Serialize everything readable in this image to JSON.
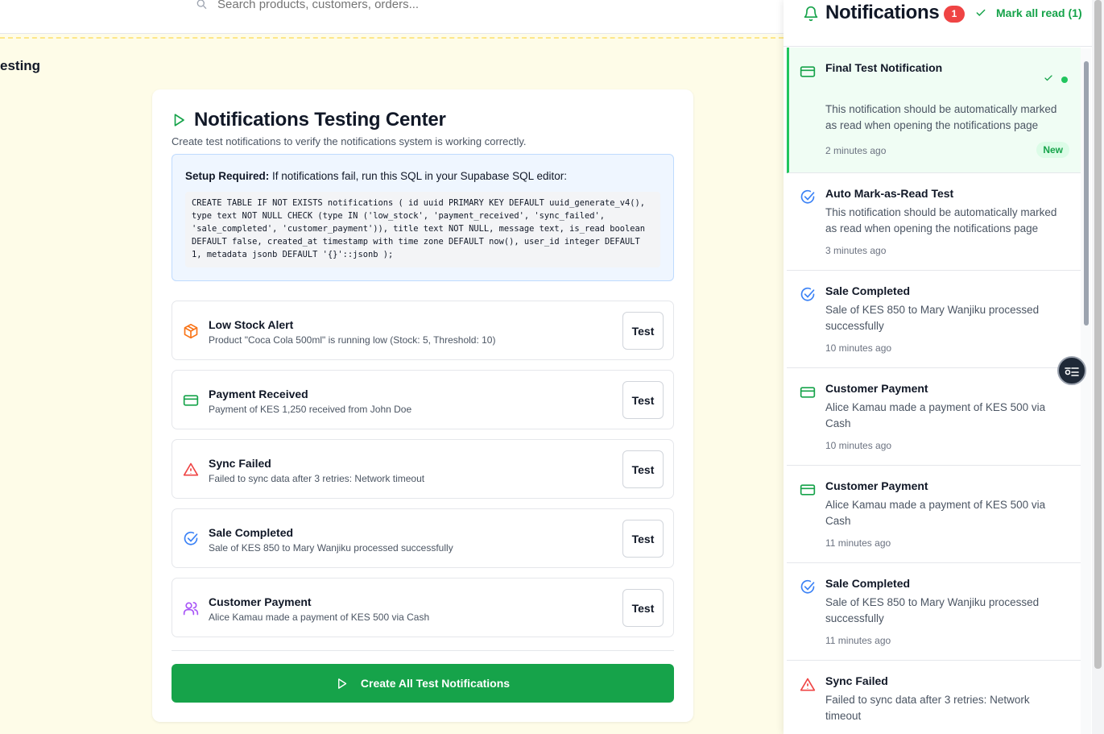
{
  "search": {
    "placeholder": "Search products, customers, orders..."
  },
  "page": {
    "heading_fragment": "esting"
  },
  "testing_center": {
    "title": "Notifications Testing Center",
    "description": "Create test notifications to verify the notifications system is working correctly.",
    "setup_label": "Setup Required:",
    "setup_text": " If notifications fail, run this SQL in your Supabase SQL editor:",
    "sql": "CREATE TABLE IF NOT EXISTS notifications ( id uuid PRIMARY KEY DEFAULT uuid_generate_v4(), type text NOT NULL CHECK (type IN ('low_stock', 'payment_received', 'sync_failed', 'sale_completed', 'customer_payment')), title text NOT NULL, message text, is_read boolean DEFAULT false, created_at timestamp with time zone DEFAULT now(), user_id integer DEFAULT 1, metadata jsonb DEFAULT '{}'::jsonb );",
    "test_button_label": "Test",
    "create_all_label": "Create All Test Notifications",
    "tests": [
      {
        "title": "Low Stock Alert",
        "desc": "Product \"Coca Cola 500ml\" is running low (Stock: 5, Threshold: 10)",
        "icon": "package-icon",
        "color": "#f97316"
      },
      {
        "title": "Payment Received",
        "desc": "Payment of KES 1,250 received from John Doe",
        "icon": "credit-card-icon",
        "color": "#16a34a"
      },
      {
        "title": "Sync Failed",
        "desc": "Failed to sync data after 3 retries: Network timeout",
        "icon": "alert-triangle-icon",
        "color": "#ef4444"
      },
      {
        "title": "Sale Completed",
        "desc": "Sale of KES 850 to Mary Wanjiku processed successfully",
        "icon": "check-circle-icon",
        "color": "#3b82f6"
      },
      {
        "title": "Customer Payment",
        "desc": "Alice Kamau made a payment of KES 500 via Cash",
        "icon": "users-icon",
        "color": "#a855f7"
      }
    ]
  },
  "panel": {
    "title": "Notifications",
    "unread_count": "1",
    "mark_all_label": "Mark all read (1)",
    "new_label": "New",
    "items": [
      {
        "title": "Final Test Notification",
        "message": "This notification should be automatically marked as read when opening the notifications page",
        "time": "2 minutes ago",
        "icon": "credit-card-icon",
        "unread": true
      },
      {
        "title": "Auto Mark-as-Read Test",
        "message": "This notification should be automatically marked as read when opening the notifications page",
        "time": "3 minutes ago",
        "icon": "check-circle-icon",
        "unread": false
      },
      {
        "title": "Sale Completed",
        "message": "Sale of KES 850 to Mary Wanjiku processed successfully",
        "time": "10 minutes ago",
        "icon": "check-circle-icon",
        "unread": false
      },
      {
        "title": "Customer Payment",
        "message": "Alice Kamau made a payment of KES 500 via Cash",
        "time": "10 minutes ago",
        "icon": "credit-card-icon",
        "unread": false
      },
      {
        "title": "Customer Payment",
        "message": "Alice Kamau made a payment of KES 500 via Cash",
        "time": "11 minutes ago",
        "icon": "credit-card-icon",
        "unread": false
      },
      {
        "title": "Sale Completed",
        "message": "Sale of KES 850 to Mary Wanjiku processed successfully",
        "time": "11 minutes ago",
        "icon": "check-circle-icon",
        "unread": false
      },
      {
        "title": "Sync Failed",
        "message": "Failed to sync data after 3 retries: Network timeout",
        "time": "",
        "icon": "alert-triangle-icon",
        "unread": false
      }
    ]
  }
}
